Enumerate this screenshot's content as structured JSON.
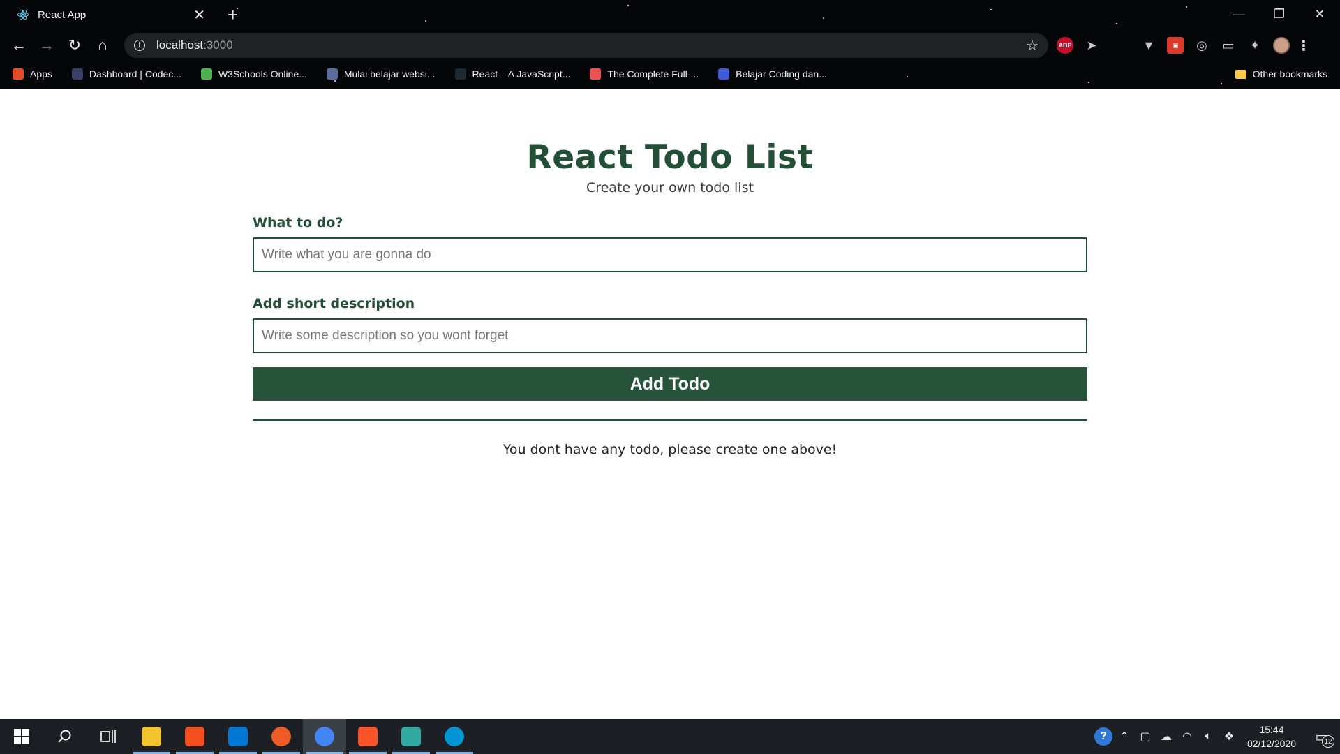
{
  "browser": {
    "tab_title": "React App",
    "url_host": "localhost",
    "url_port": ":3000",
    "bookmarks": [
      {
        "label": "Apps",
        "icon": "apps-grid-icon",
        "color": "#e44d26"
      },
      {
        "label": "Dashboard | Codec...",
        "icon": "codecademy-icon",
        "color": "#3a3f66"
      },
      {
        "label": "W3Schools Online...",
        "icon": "w3schools-icon",
        "color": "#4caf50"
      },
      {
        "label": "Mulai belajar websi...",
        "icon": "site-icon",
        "color": "#5b6b9a"
      },
      {
        "label": "React – A JavaScript...",
        "icon": "react-icon",
        "color": "#1e2a33"
      },
      {
        "label": "The Complete Full-...",
        "icon": "udemy-icon",
        "color": "#ec5252"
      },
      {
        "label": "Belajar Coding dan...",
        "icon": "blue-circle-icon",
        "color": "#3b5bdb"
      }
    ],
    "other_bookmarks": "Other bookmarks",
    "extensions": {
      "abp_label": "ABP"
    }
  },
  "app": {
    "title": "React Todo List",
    "subtitle": "Create your own todo list",
    "todo_label": "What to do?",
    "todo_placeholder": "Write what you are gonna do",
    "todo_value": "",
    "desc_label": "Add short description",
    "desc_placeholder": "Write some description so you wont forget",
    "desc_value": "",
    "add_button": "Add Todo",
    "empty_message": "You dont have any todo, please create one above!",
    "accent_color": "#234f37"
  },
  "taskbar": {
    "apps": [
      {
        "name": "file-explorer-icon",
        "color": "#f4c430"
      },
      {
        "name": "figma-icon",
        "color": "#f24e1e"
      },
      {
        "name": "vscode-icon",
        "color": "#0078d4"
      },
      {
        "name": "postman-icon",
        "color": "#ef5b25"
      },
      {
        "name": "chrome-icon",
        "color": "#4285f4"
      },
      {
        "name": "brave-icon",
        "color": "#fb542b"
      },
      {
        "name": "git-kraken-icon",
        "color": "#31a8a0"
      },
      {
        "name": "hp-icon",
        "color": "#0096d6"
      }
    ],
    "active_app": "chrome-icon",
    "clock_time": "15:44",
    "clock_date": "02/12/2020",
    "notification_count": "12"
  }
}
